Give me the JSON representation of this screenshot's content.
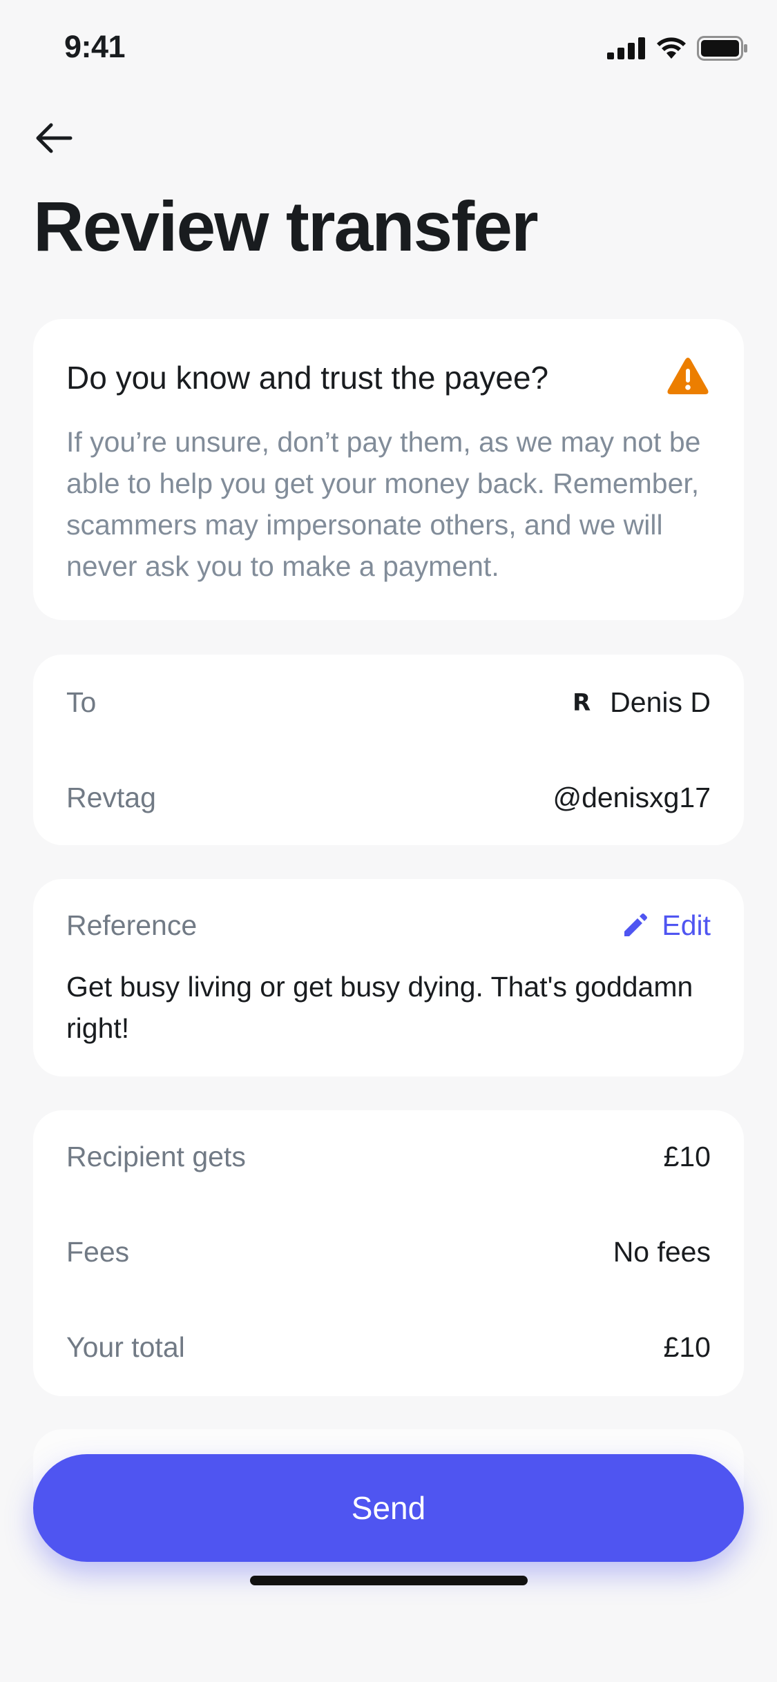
{
  "status_bar": {
    "time": "9:41"
  },
  "page": {
    "title": "Review transfer"
  },
  "warning": {
    "title": "Do you know and trust the payee?",
    "body": "If you’re unsure, don’t pay them, as we may not be able to help you get your money back. Remember, scammers may impersonate others, and we will never ask you to make a payment.",
    "icon": "warning-triangle-icon",
    "icon_color": "#ec7e00"
  },
  "recipient": {
    "to_label": "To",
    "payee_logo": "R",
    "payee_name": "Denis D",
    "revtag_label": "Revtag",
    "revtag_value": "@denisxg17"
  },
  "reference": {
    "label": "Reference",
    "edit_label": "Edit",
    "text": "Get busy living or get busy dying. That's goddamn right!"
  },
  "amounts": {
    "recipient_gets_label": "Recipient gets",
    "recipient_gets_value": "£10",
    "fees_label": "Fees",
    "fees_value": "No fees",
    "total_label": "Your total",
    "total_value": "£10"
  },
  "actions": {
    "send_label": "Send"
  },
  "colors": {
    "accent": "#4f55f1",
    "background": "#f7f7f8",
    "card": "#ffffff",
    "muted_text": "#818c99"
  }
}
